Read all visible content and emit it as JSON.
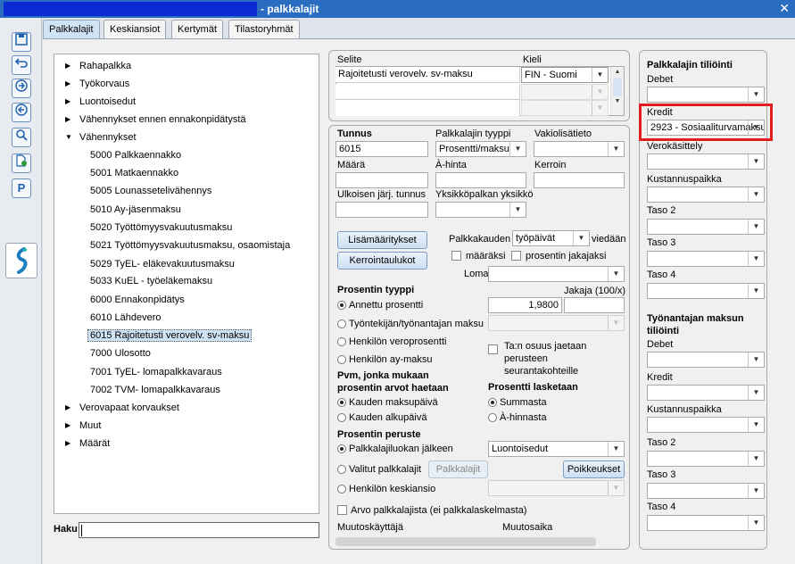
{
  "window": {
    "title": "- palkkalajit",
    "close": "✕"
  },
  "toolbar": {
    "icons": [
      "save-icon",
      "undo-icon",
      "forward-icon",
      "back-icon",
      "search-icon",
      "new-document-icon",
      "p-icon"
    ],
    "p_label": "P"
  },
  "tabs": [
    "Palkkalajit",
    "Keskiansiot",
    "Kertymät",
    "Tilastoryhmät"
  ],
  "tree": {
    "top": [
      "Rahapalkka",
      "Työkorvaus",
      "Luontoisedut",
      "Vähennykset ennen ennakonpidätystä",
      "Vähennykset"
    ],
    "children": [
      "5000 Palkkaennakko",
      "5001 Matkaennakko",
      "5005 Lounasseteli­vähennys",
      "5010 Ay-jäsenmaksu",
      "5020 Työttömyysvakuutusmaksu",
      "5021 Työttömyysvakuutusmaksu, osaomistaja",
      "5029 TyEL- eläkevakuutusmaksu",
      "5033 KuEL - työeläkemaksu",
      "6000 Ennakonpidätys",
      "6010 Lähdevero",
      "6015 Rajoitetusti verovelv. sv-maksu",
      "7000 Ulosotto",
      "7001 TyEL- lomapalkkavaraus",
      "7002 TVM- lomapalkkavaraus"
    ],
    "bottom": [
      "Verovapaat korvaukset",
      "Muut",
      "Määrät"
    ],
    "selected_index": 10
  },
  "search": {
    "label": "Haku",
    "value": ""
  },
  "selite": {
    "header_desc": "Selite",
    "header_lang": "Kieli",
    "rows": [
      {
        "desc": "Rajoitetusti verovelv. sv-maksu",
        "lang": "FIN - Suomi"
      },
      {
        "desc": "",
        "lang": ""
      },
      {
        "desc": "",
        "lang": ""
      }
    ]
  },
  "form": {
    "tunnus_label": "Tunnus",
    "tunnus": "6015",
    "tyyppi_label": "Palkkalajin tyyppi",
    "tyyppi": "Prosentti/maksu",
    "vakio_label": "Vakiolisätieto",
    "vakio": "",
    "maara_label": "Määrä",
    "maara": "",
    "ahinta_label": "À-hinta",
    "ahinta": "",
    "kerroin_label": "Kerroin",
    "kerroin": "",
    "ulkoinen_label": "Ulkoisen järj. tunnus",
    "ulkoinen": "",
    "yksikko_label": "Yksikköpalkan yksikkö",
    "yksikko": "",
    "lisamaaritykset": "Lisämääritykset",
    "kerrointaulukot": "Kerrointaulukot",
    "palkkakauden_label": "Palkkakauden",
    "palkkakauden": "työpäivät",
    "viedaan": "viedään",
    "maaraksi": "määräksi",
    "prosentin_jakajaksi": "prosentin jakajaksi",
    "loma_label": "Loma",
    "loma": "",
    "prosentin_tyyppi": "Prosentin tyyppi",
    "jakaja_label": "Jakaja (100/x)",
    "annettu": "Annettu prosentti",
    "annettu_value": "1,9800",
    "jakaja": "",
    "tyontekijan": "Työntekijän/työnantajan maksu",
    "veroprosentti": "Henkilön veroprosentti",
    "ay_maksu": "Henkilön ay-maksu",
    "tan_osuus": "Ta:n osuus jaetaan perusteen seurantakohteille",
    "pvm_title": "Pvm, jonka mukaan prosentin arvot haetaan",
    "kauden_maksupaiva": "Kauden maksupäivä",
    "kauden_alkupaiva": "Kauden alkupäivä",
    "prosentti_lasketaan": "Prosentti lasketaan",
    "summasta": "Summasta",
    "ahinnasta": "À-hinnasta",
    "prosentin_peruste": "Prosentin peruste",
    "palkkalajiluokan": "Palkkalajiluokan jälkeen",
    "peruste_value": "Luontoisedut",
    "valitut": "Valitut palkkalajit",
    "palkkalajit_btn": "Palkkalajit",
    "poikkeukset": "Poikkeukset",
    "keskiansio": "Henkilön keskiansio",
    "arvo": "Arvo palkkalajista (ei palkkalaskelmasta)",
    "muutoskayttaja": "Muutoskäyttäjä",
    "muutosaika": "Muutosaika"
  },
  "tiliointi": {
    "title": "Palkkalajin tiliöinti",
    "debet_label": "Debet",
    "debet": "",
    "kredit_label": "Kredit",
    "kredit": "2923 - Sosiaaliturvamaksu",
    "verokasittely_label": "Verokäsittely",
    "verokasittely": "",
    "kustannuspaikka_label": "Kustannuspaikka",
    "kustannuspaikka": "",
    "taso2_label": "Taso 2",
    "taso3_label": "Taso 3",
    "taso4_label": "Taso 4",
    "tyonantaja_title": "Työnantajan maksun tiliöinti",
    "t_debet_label": "Debet",
    "t_kredit_label": "Kredit",
    "t_kustannus_label": "Kustannuspaikka",
    "t_taso2_label": "Taso 2",
    "t_taso3_label": "Taso 3",
    "t_taso4_label": "Taso 4"
  }
}
